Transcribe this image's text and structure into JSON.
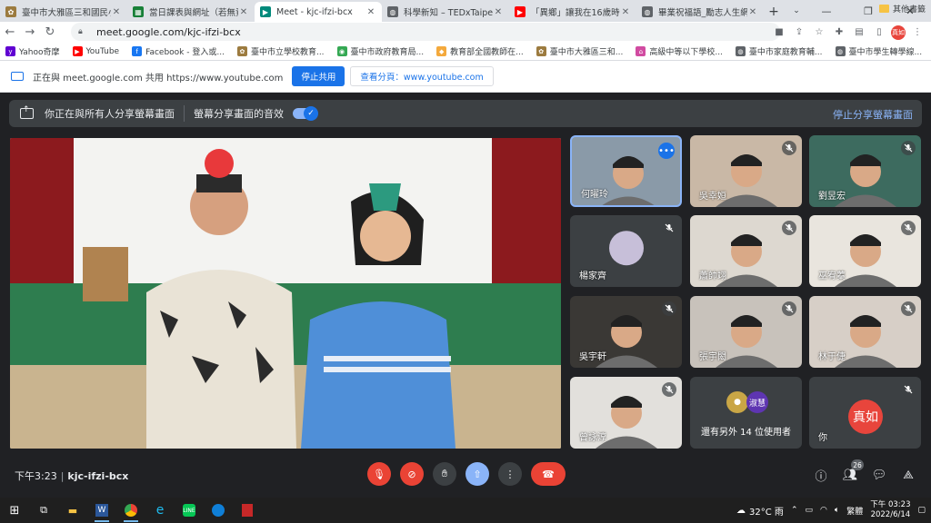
{
  "browser": {
    "tabs": [
      {
        "title": "臺中市大雅區三和國民小學",
        "color": "#9c7b3f",
        "glyph": "✿"
      },
      {
        "title": "當日課表與網址（若無資料",
        "color": "#188038",
        "glyph": "▦"
      },
      {
        "title": "Meet - kjc-ifzi-bcx",
        "color": "#00897b",
        "glyph": "▶",
        "active": true
      },
      {
        "title": "科學新知 – TEDxTaipei",
        "color": "#5f6368",
        "glyph": "◍"
      },
      {
        "title": "「異鄉」讓我在16歲時",
        "color": "#ff0000",
        "glyph": "▶"
      },
      {
        "title": "畢業祝福語_勵志人生網_",
        "color": "#5f6368",
        "glyph": "◍"
      }
    ],
    "url": "meet.google.com/kjc-ifzi-bcx",
    "profile_label": "真如",
    "bookmarks": [
      {
        "label": "Yahoo奇摩",
        "color": "#6001d2",
        "glyph": "y"
      },
      {
        "label": "YouTube",
        "color": "#ff0000",
        "glyph": "▶"
      },
      {
        "label": "Facebook - 登入或...",
        "color": "#1877f2",
        "glyph": "f"
      },
      {
        "label": "臺中市立學校教育...",
        "color": "#9c7b3f",
        "glyph": "✿"
      },
      {
        "label": "臺中市政府教育局...",
        "color": "#34a853",
        "glyph": "◉"
      },
      {
        "label": "教育部全國教師在...",
        "color": "#f4a93c",
        "glyph": "◆"
      },
      {
        "label": "臺中市大雅區三和...",
        "color": "#9c7b3f",
        "glyph": "✿"
      },
      {
        "label": "高級中等以下學校...",
        "color": "#d14ba1",
        "glyph": "⌂"
      },
      {
        "label": "臺中市家庭教育輔...",
        "color": "#5f6368",
        "glyph": "◍"
      },
      {
        "label": "臺中市學生轉學線...",
        "color": "#5f6368",
        "glyph": "◍"
      }
    ],
    "other_bookmarks": "其他書籤"
  },
  "share_bar": {
    "status_text": "正在與 meet.google.com 共用 https://www.youtube.com",
    "stop_button": "停止共用",
    "view_button": "查看分頁：www.youtube.com"
  },
  "meet": {
    "banner_text": "你正在與所有人分享螢幕畫面",
    "audio_text": "螢幕分享畫面的音效",
    "stop_presenting": "停止分享螢幕畫面",
    "participants": [
      {
        "name": "何曜玲",
        "muted": false,
        "speaking": true,
        "bg": "#8a9aa8"
      },
      {
        "name": "吳幸姮",
        "muted": true,
        "bg": "#c9b8a6"
      },
      {
        "name": "劉昱宏",
        "muted": true,
        "bg": "#3d6b5f"
      },
      {
        "name": "楊家齊",
        "muted": true,
        "bg": "#3c4043",
        "avatar": true
      },
      {
        "name": "蕭帥翊",
        "muted": true,
        "bg": "#ddd8d0"
      },
      {
        "name": "巫宥蓁",
        "muted": true,
        "bg": "#e9e5de"
      },
      {
        "name": "吳宇軒",
        "muted": true,
        "bg": "#3a3835"
      },
      {
        "name": "張宇閎",
        "muted": true,
        "bg": "#c8c2bb"
      },
      {
        "name": "林于倢",
        "muted": true,
        "bg": "#d7cfc7"
      },
      {
        "name": "曾詠淳",
        "muted": true,
        "bg": "#e2e0dc"
      }
    ],
    "more_tile": {
      "avatar_label": "淑慧",
      "text": "還有另外 14 位使用者"
    },
    "self_tile": {
      "name": "你",
      "avatar_label": "真如"
    },
    "time": "下午3:23",
    "meeting_code": "kjc-ifzi-bcx",
    "people_count": "26"
  },
  "taskbar": {
    "weather": "32°C 雨",
    "ime": "繁體",
    "time": "下午 03:23",
    "date": "2022/6/14"
  }
}
